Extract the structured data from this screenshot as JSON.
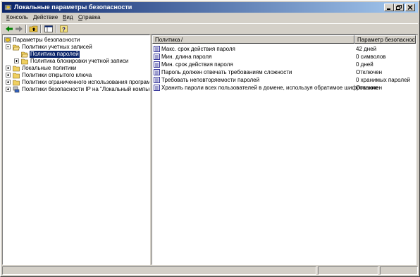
{
  "window": {
    "title": "Локальные параметры безопасности"
  },
  "menu": [
    "Консоль",
    "Действие",
    "Вид",
    "Справка"
  ],
  "tree": [
    {
      "label": "Параметры безопасности"
    },
    {
      "label": "Политики учетных записей"
    },
    {
      "label": "Политика паролей"
    },
    {
      "label": "Политика блокировки учетной записи"
    },
    {
      "label": "Локальные политики"
    },
    {
      "label": "Политики открытого ключа"
    },
    {
      "label": "Политики ограниченного использования программ"
    },
    {
      "label": "Политики безопасности IP на \"Локальный компьютер\""
    }
  ],
  "list": {
    "headers": {
      "policy": "Политика",
      "sort_indicator": "/",
      "setting": "Параметр безопасности"
    },
    "rows": [
      {
        "policy": "Макс. срок действия пароля",
        "setting": "42 дней"
      },
      {
        "policy": "Мин. длина пароля",
        "setting": "0 символов"
      },
      {
        "policy": "Мин. срок действия пароля",
        "setting": "0 дней"
      },
      {
        "policy": "Пароль должен отвечать требованиям сложности",
        "setting": "Отключен"
      },
      {
        "policy": "Требовать неповторяемости паролей",
        "setting": "0 хранимых паролей"
      },
      {
        "policy": "Хранить пароли всех пользователей в домене, используя обратимое шифрование",
        "setting": "Отключен"
      }
    ]
  },
  "colors": {
    "titlebar_start": "#0a246a",
    "titlebar_end": "#a6caf0",
    "selection": "#0a246a",
    "face": "#d4d0c8"
  },
  "icons": [
    "app-icon",
    "back-icon",
    "forward-icon",
    "up-folder-icon",
    "show-hide-tree-icon",
    "help-icon",
    "folder-icon",
    "open-folder-icon",
    "shield-computer-icon",
    "policy-icon"
  ]
}
